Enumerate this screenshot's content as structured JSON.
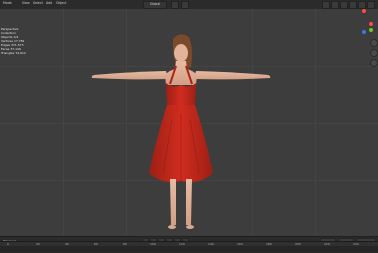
{
  "topbar": {
    "menus": [
      "Mode",
      "View",
      "Select",
      "Add",
      "Object"
    ],
    "viewport_shading": "Global"
  },
  "stats": {
    "title": "Perspective",
    "subtitle": "Collection",
    "lines": [
      {
        "label": "Objects",
        "value": "1/4"
      },
      {
        "label": "Vertices",
        "value": "17,781"
      },
      {
        "label": "Edges",
        "value": "371,573"
      },
      {
        "label": "Faces",
        "value": "37,149"
      },
      {
        "label": "Triangles",
        "value": "74,612"
      }
    ]
  },
  "timeline": {
    "mode": "Playback",
    "frame_labels": [
      "0",
      "20",
      "40",
      "60",
      "80",
      "100",
      "120",
      "140",
      "160",
      "180",
      "200",
      "220",
      "240"
    ]
  },
  "colors": {
    "dress": "#c0281c",
    "skin": "#e2b39a",
    "hair": "#7a4a2a",
    "grid": "#444444",
    "background": "#3d3d3d"
  },
  "icons": [
    "move-icon",
    "camera-icon",
    "hand-icon",
    "zoom-icon",
    "play-icon",
    "prev-frame-icon",
    "next-frame-icon"
  ]
}
